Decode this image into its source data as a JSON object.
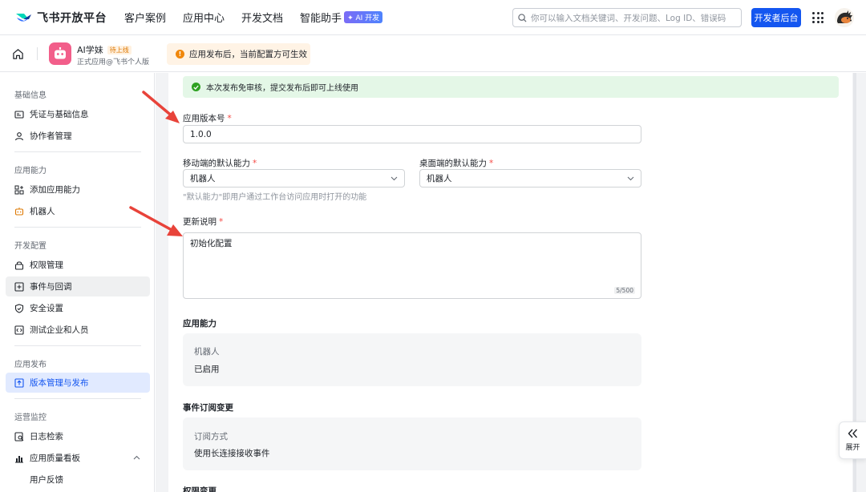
{
  "topbar": {
    "logo_text": "飞书开放平台",
    "nav": [
      "客户案例",
      "应用中心",
      "开发文档",
      "智能助手"
    ],
    "ai_badge": "✦ AI 开发",
    "search_placeholder": "你可以输入文档关键词、开发问题、Log ID、错误码",
    "dev_button": "开发者后台"
  },
  "appbar": {
    "app_name": "AI学妹",
    "status_tag": "待上线",
    "app_sub": "正式应用@飞书个人版",
    "notice": "应用发布后，当前配置方可生效"
  },
  "sidebar": {
    "sections": [
      {
        "title": "基础信息",
        "items": [
          {
            "label": "凭证与基础信息",
            "icon": "id-card-icon"
          },
          {
            "label": "协作者管理",
            "icon": "user-icon"
          }
        ]
      },
      {
        "title": "应用能力",
        "items": [
          {
            "label": "添加应用能力",
            "icon": "apps-add-icon"
          },
          {
            "label": "机器人",
            "icon": "robot-icon"
          }
        ]
      },
      {
        "title": "开发配置",
        "items": [
          {
            "label": "权限管理",
            "icon": "lock-icon"
          },
          {
            "label": "事件与回调",
            "icon": "event-icon"
          },
          {
            "label": "安全设置",
            "icon": "shield-icon"
          },
          {
            "label": "测试企业和人员",
            "icon": "test-icon"
          }
        ]
      },
      {
        "title": "应用发布",
        "items": [
          {
            "label": "版本管理与发布",
            "icon": "upload-icon"
          }
        ]
      },
      {
        "title": "运营监控",
        "items": [
          {
            "label": "日志检索",
            "icon": "log-search-icon"
          },
          {
            "label": "应用质量看板",
            "icon": "chart-icon"
          },
          {
            "label": "用户反馈",
            "icon": ""
          }
        ]
      }
    ]
  },
  "form": {
    "success_banner": "本次发布免审核，提交发布后即可上线使用",
    "version_label": "应用版本号",
    "version_value": "1.0.0",
    "mobile_label": "移动端的默认能力",
    "mobile_value": "机器人",
    "desktop_label": "桌面端的默认能力",
    "desktop_value": "机器人",
    "default_hint": "\"默认能力\"即用户通过工作台访问应用时打开的功能",
    "notes_label": "更新说明",
    "notes_value": "初始化配置",
    "notes_count": "5/500",
    "required_mark": "*"
  },
  "capabilities": {
    "title": "应用能力",
    "name": "机器人",
    "status": "已启用"
  },
  "events": {
    "title": "事件订阅变更",
    "method_label": "订阅方式",
    "method_value": "使用长连接接收事件"
  },
  "permissions": {
    "title": "权限变更"
  },
  "expand": {
    "label": "展开"
  },
  "colors": {
    "primary": "#1456f0",
    "success": "#2ea121",
    "warning": "#f0870c",
    "required": "#f54a45",
    "arrow": "#e8433a"
  }
}
